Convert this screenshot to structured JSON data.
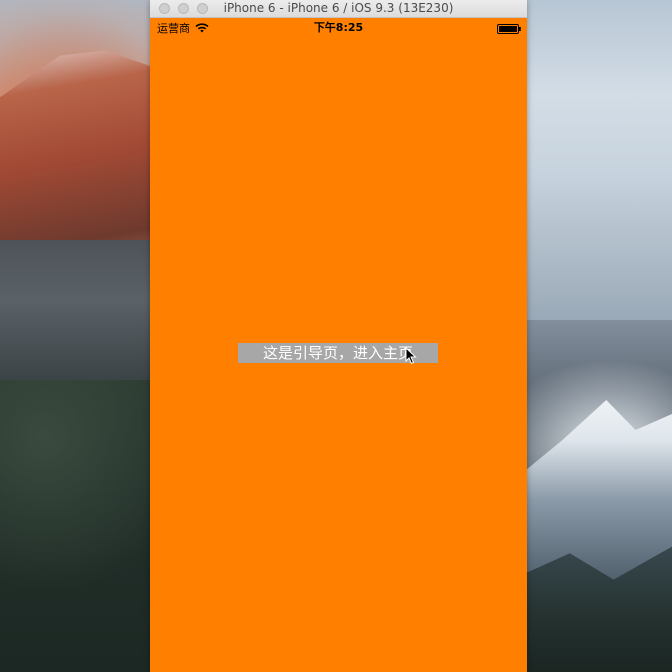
{
  "window": {
    "title": "iPhone 6 - iPhone 6 / iOS 9.3 (13E230)",
    "traffic_lights": [
      "close-button",
      "minimize-button",
      "zoom-button"
    ]
  },
  "status_bar": {
    "carrier": "运营商",
    "time": "下午8:25",
    "icons": [
      "wifi-icon",
      "battery-icon"
    ]
  },
  "screen": {
    "background_color": "#ff8000",
    "guide_button_label": "这是引导页，进入主页",
    "guide_button_color": "#a7a7a7"
  },
  "cursor": {
    "icon": "arrow-cursor-icon"
  }
}
